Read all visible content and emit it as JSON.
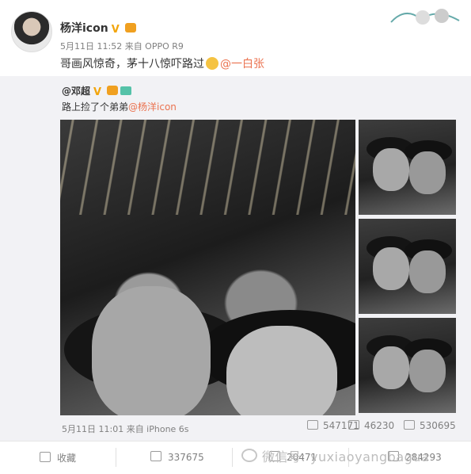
{
  "author": {
    "name": "杨洋icon",
    "meta": "5月11日 11:52 来自 OPPO R9"
  },
  "post": {
    "text": "哥画风惊奇，茅十八惊吓路过",
    "mention": "@一白张"
  },
  "quoted": {
    "name": "@邓超",
    "text_prefix": "路上捡了个弟弟",
    "text_mention": "@杨洋icon",
    "meta": "5月11日 11:01 来自 iPhone 6s",
    "reposts": "547171",
    "comments": "46230",
    "likes": "530695"
  },
  "toolbar": {
    "favorite_label": "收藏",
    "repost_count": "337675",
    "comment_count": "20471",
    "like_count": "284293"
  },
  "watermark": {
    "text": "微信号: yuxiaoyangbagua"
  },
  "icons": [
    "avatar",
    "verified-v-icon",
    "crown-icon",
    "emoji-icon",
    "camera-icon",
    "repost-icon",
    "comment-icon",
    "like-icon",
    "star-icon",
    "wechat-icon"
  ],
  "colors": {
    "mention": "#eb7350",
    "verified": "#f2a50c",
    "muted": "#808080",
    "quoted_bg": "#f2f2f5"
  }
}
